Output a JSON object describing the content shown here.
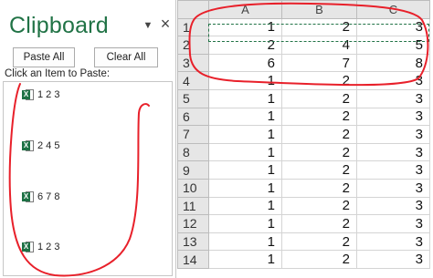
{
  "clipboard": {
    "title": "Clipboard",
    "options_glyph": "▼",
    "close_glyph": "×",
    "paste_all_label": "Paste All",
    "clear_all_label": "Clear All",
    "instruction": "Click an Item to Paste:",
    "item_icon": "excel-icon",
    "items": [
      {
        "text": "1 2 3"
      },
      {
        "text": "2 4 5"
      },
      {
        "text": "6 7 8"
      },
      {
        "text": "1 2 3"
      }
    ]
  },
  "grid": {
    "columns": [
      "A",
      "B",
      "C"
    ],
    "rows": [
      {
        "n": "1",
        "cells": [
          "1",
          "2",
          "3"
        ]
      },
      {
        "n": "2",
        "cells": [
          "2",
          "4",
          "5"
        ]
      },
      {
        "n": "3",
        "cells": [
          "6",
          "7",
          "8"
        ]
      },
      {
        "n": "4",
        "cells": [
          "1",
          "2",
          "3"
        ]
      },
      {
        "n": "5",
        "cells": [
          "1",
          "2",
          "3"
        ]
      },
      {
        "n": "6",
        "cells": [
          "1",
          "2",
          "3"
        ]
      },
      {
        "n": "7",
        "cells": [
          "1",
          "2",
          "3"
        ]
      },
      {
        "n": "8",
        "cells": [
          "1",
          "2",
          "3"
        ]
      },
      {
        "n": "9",
        "cells": [
          "1",
          "2",
          "3"
        ]
      },
      {
        "n": "10",
        "cells": [
          "1",
          "2",
          "3"
        ]
      },
      {
        "n": "11",
        "cells": [
          "1",
          "2",
          "3"
        ]
      },
      {
        "n": "12",
        "cells": [
          "1",
          "2",
          "3"
        ]
      },
      {
        "n": "13",
        "cells": [
          "1",
          "2",
          "3"
        ]
      },
      {
        "n": "14",
        "cells": [
          "1",
          "2",
          "3"
        ]
      }
    ]
  },
  "colors": {
    "accent_green": "#217346",
    "annotation_red": "#e8202a"
  }
}
